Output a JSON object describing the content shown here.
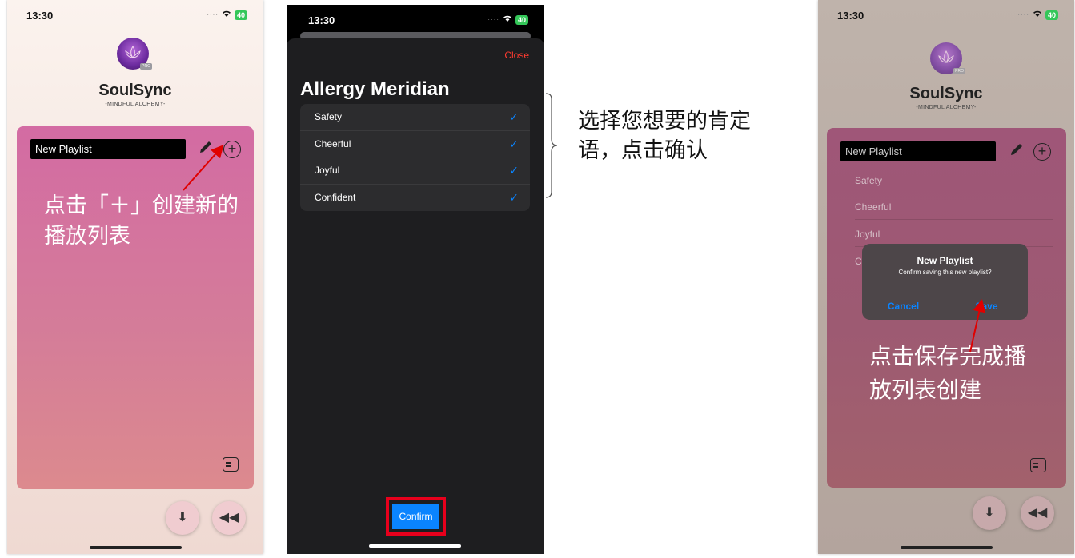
{
  "status": {
    "time": "13:30",
    "battery": "40"
  },
  "app": {
    "name": "SoulSync",
    "tagline": "-MINDFUL ALCHEMY-",
    "badge": "PRO"
  },
  "screen1": {
    "playlist_name": "New Playlist",
    "annotation": "点击「＋」创建新的播放列表"
  },
  "screen2": {
    "close_label": "Close",
    "title": "Allergy Meridian",
    "affirmations": [
      {
        "label": "Safety",
        "checked": true
      },
      {
        "label": "Cheerful",
        "checked": true
      },
      {
        "label": "Joyful",
        "checked": true
      },
      {
        "label": "Confident",
        "checked": true
      }
    ],
    "confirm_label": "Confirm",
    "annotation": "选择您想要的肯定语，点击确认"
  },
  "screen3": {
    "playlist_name": "New Playlist",
    "rows": [
      "Safety",
      "Cheerful",
      "Joyful",
      "C"
    ],
    "alert": {
      "title": "New Playlist",
      "message": "Confirm saving this new playlist?",
      "cancel": "Cancel",
      "save": "Save"
    },
    "annotation": "点击保存完成播放列表创建"
  },
  "icons": {
    "edit": "pencil-icon",
    "add": "plus-circle-icon",
    "chat": "chat-icon",
    "download": "download-icon",
    "back": "rewind-icon",
    "check": "checkmark-icon"
  },
  "colors": {
    "accent_blue": "#0a84ff",
    "close_red": "#ff3b30",
    "highlight_red": "#e8001c",
    "arrow_red": "#e00000",
    "battery_green": "#34c759"
  }
}
